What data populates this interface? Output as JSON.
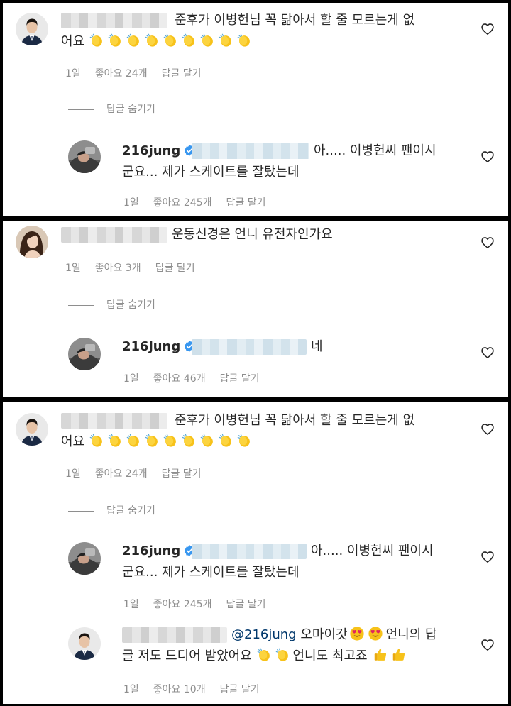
{
  "comments": {
    "c1": {
      "text_line1": "준후가 이병헌님 꼭 닮아서 할 줄 모르는게 없",
      "text_line2": "어요",
      "age": "1일",
      "likes": "좋아요 24개",
      "reply": "답글 달기",
      "hide_replies": "답글 숨기기",
      "clap_count": 9
    },
    "r1": {
      "username": "216jung",
      "text_line1": "아..... 이병헌씨 팬이시",
      "text_line2": "군요... 제가 스케이트를 잘탔는데",
      "age": "1일",
      "likes": "좋아요 245개",
      "reply": "답글 달기"
    },
    "c2": {
      "text": "운동신경은 언니 유전자인가요",
      "age": "1일",
      "likes": "좋아요 3개",
      "reply": "답글 달기",
      "hide_replies": "답글 숨기기"
    },
    "r2": {
      "username": "216jung",
      "text": "네",
      "age": "1일",
      "likes": "좋아요 46개",
      "reply": "답글 달기"
    },
    "c3": {
      "text_line1": "준후가 이병헌님 꼭 닮아서 할 줄 모르는게 없",
      "text_line2": "어요",
      "age": "1일",
      "likes": "좋아요 24개",
      "reply": "답글 달기",
      "hide_replies": "답글 숨기기",
      "clap_count": 9
    },
    "r3": {
      "username": "216jung",
      "text_line1": "아..... 이병헌씨 팬이시",
      "text_line2": "군요... 제가 스케이트를 잘탔는데",
      "age": "1일",
      "likes": "좋아요 245개",
      "reply": "답글 달기"
    },
    "r4": {
      "mention": "@216jung",
      "text_line1_a": "오마이갓",
      "text_line1_b": "언니의 답",
      "text_line2_a": "글 저도 드디어 받았어요",
      "text_line2_b": "언니도 최고죠",
      "age": "1일",
      "likes": "좋아요 10개",
      "reply": "답글 달기"
    }
  },
  "icons": {
    "heart": "heart-outline-icon",
    "verified": "verified-badge-icon",
    "clap": "clapping-hands-emoji",
    "heart_eyes": "smiling-face-heart-eyes-emoji",
    "thumbs_up": "thumbs-up-emoji"
  },
  "colors": {
    "text": "#262626",
    "meta": "#8e8e8e",
    "verified": "#3897f0",
    "mention": "#00376b"
  }
}
